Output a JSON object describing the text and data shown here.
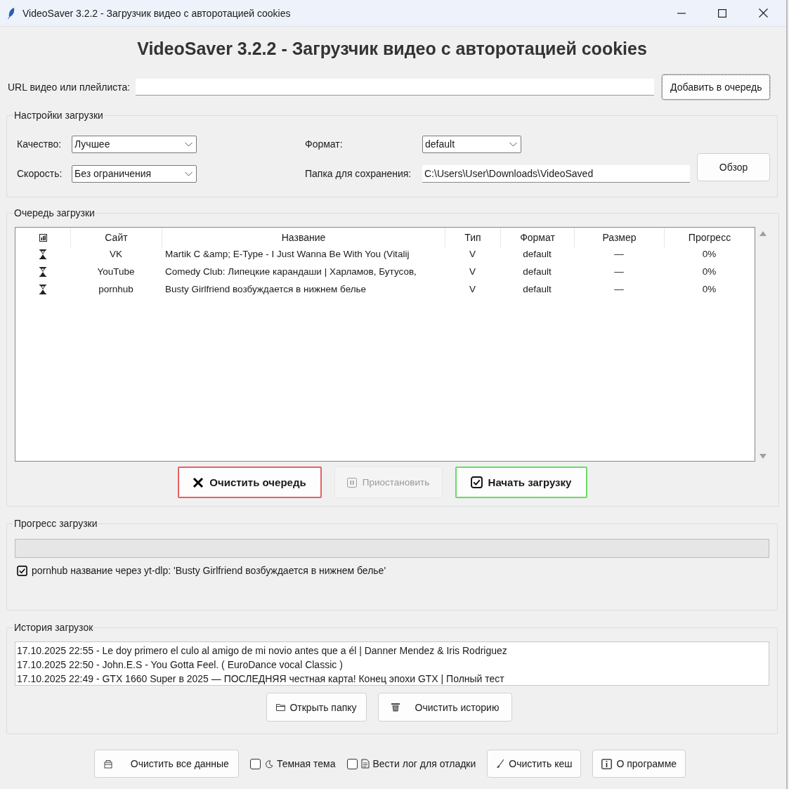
{
  "window": {
    "title": "VideoSaver 3.2.2 - Загрузчик видео с авторотацией cookies"
  },
  "heading": "VideoSaver 3.2.2 - Загрузчик видео с авторотацией cookies",
  "url": {
    "label": "URL видео или плейлиста:",
    "add_button": "Добавить в очередь"
  },
  "settings": {
    "title": "Настройки загрузки",
    "fields": [
      {
        "kind": "combo",
        "label": "Качество:",
        "value": "Лучшее"
      },
      {
        "kind": "combo",
        "label": "Формат:",
        "value": "default"
      },
      {
        "kind": "combo",
        "label": "Скорость:",
        "value": "Без ограничения"
      },
      {
        "kind": "entry",
        "label": "Папка для сохранения:",
        "value": "C:\\Users\\User\\Downloads\\VideoSaved"
      }
    ],
    "browse_button": "Обзор"
  },
  "queue": {
    "title": "Очередь загрузки",
    "columns": [
      "Сайт",
      "Название",
      "Тип",
      "Формат",
      "Размер",
      "Прогресс"
    ],
    "rows": [
      {
        "site": "VK",
        "name": "Martik C &amp; E-Type - I Just Wanna Be With You (Vitalij",
        "type": "V",
        "format": "default",
        "size": "—",
        "progress": "0%"
      },
      {
        "site": "YouTube",
        "name": "Comedy Club: Липецкие карандаши | Харламов, Бутусов,",
        "type": "V",
        "format": "default",
        "size": "—",
        "progress": "0%"
      },
      {
        "site": "pornhub",
        "name": "Busty Girlfriend возбуждается в нижнем белье",
        "type": "V",
        "format": "default",
        "size": "—",
        "progress": "0%"
      }
    ],
    "buttons": [
      {
        "kind": "clear",
        "label": "Очистить очередь",
        "disabled": false
      },
      {
        "kind": "pause",
        "label": "Приостановить",
        "disabled": true
      },
      {
        "kind": "start",
        "label": "Начать загрузку",
        "disabled": false
      }
    ]
  },
  "progress": {
    "title": "Прогресс загрузки",
    "level": 0,
    "status": "pornhub название через yt-dlp: 'Busty Girlfriend возбуждается в нижнем белье'"
  },
  "history": {
    "title": "История загрузок",
    "entries": [
      "17.10.2025 22:55 - Le doy primero el culo al amigo de mi novio antes que a él | Danner Mendez & Iris Rodriguez",
      "17.10.2025 22:50 - John.E.S - You Gotta Feel. ( EuroDance vocal Classic )",
      "17.10.2025 22:49 - GTX 1660 Super в 2025 — ПОСЛЕДНЯЯ честная карта! Конец эпохи GTX | Полный тест"
    ],
    "buttons": [
      "Открыть папку",
      "Очистить историю"
    ]
  },
  "footer": [
    {
      "kind": "button",
      "label": "Очистить все данные"
    },
    {
      "kind": "checkbox",
      "label": "Темная тема",
      "checked": false
    },
    {
      "kind": "checkbox",
      "label": "Вести лог для отладки",
      "checked": false
    },
    {
      "kind": "button",
      "label": "Очистить кеш"
    },
    {
      "kind": "button",
      "label": "О программе"
    }
  ]
}
